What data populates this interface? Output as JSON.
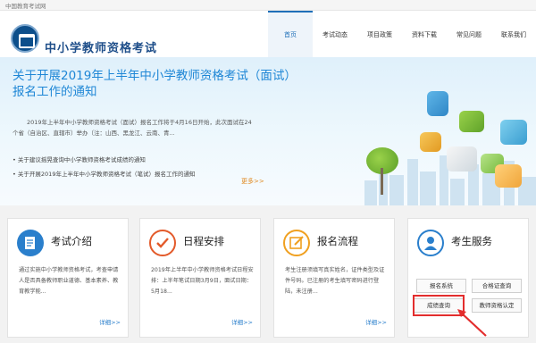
{
  "topbar": {
    "text": "中国教育考试网"
  },
  "header": {
    "title": "中小学教师资格考试"
  },
  "nav": [
    "首页",
    "考试动态",
    "项目政策",
    "资料下载",
    "常见问题",
    "联系我们"
  ],
  "banner": {
    "title": "关于开展2019年上半年中小学教师资格考试（面试）报名工作的通知",
    "desc": "2019年上半年中小学教师资格考试（面试）报名工作将于4月16日开始，此次面试在24个省（自治区、直辖市）举办（注：山西、黑龙江、云南、青...",
    "items": [
      "关于建议摇晃查询中小学教师资格考试成绩的通知",
      "关于开展2019年上半年中小学教师资格考试（笔试）报名工作的通知"
    ],
    "more": "更多>>"
  },
  "cards": [
    {
      "title": "考试介绍",
      "text": "通过实施中小学教师资格考试，考查申请人是否具备教师职业道德、基本素养、教育教学能...",
      "more": "详细>>",
      "icon": "document-pencil-icon",
      "color": "#2a7fcc"
    },
    {
      "title": "日程安排",
      "text": "2019年上半年中小学教师资格考试日程安排：上半年笔试日期3月9日，面试日期：5月18...",
      "more": "详细>>",
      "icon": "checkmark-icon",
      "color": "#e35a2a"
    },
    {
      "title": "报名流程",
      "text": "考生注册须填写真实姓名，证件类型及证件号码。已注册的考生填写密码进行登陆，未注册...",
      "more": "详细>>",
      "icon": "edit-icon",
      "color": "#f0a020"
    },
    {
      "title": "考生服务",
      "icon": "person-service-icon",
      "color": "#2a7fcc",
      "buttons": [
        "报名系统",
        "合格证查询",
        "成绩查询",
        "教师资格认定"
      ]
    }
  ]
}
